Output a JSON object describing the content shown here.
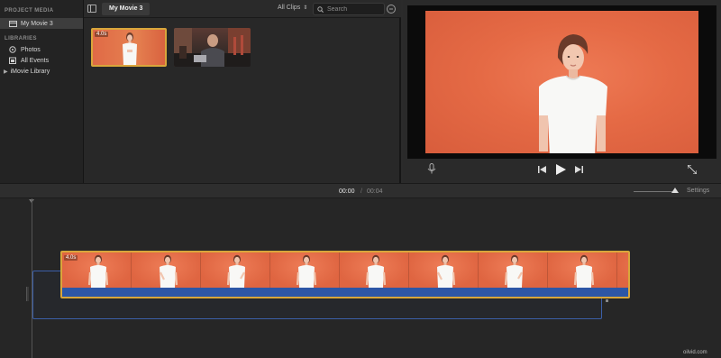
{
  "sidebar": {
    "project_media_header": "PROJECT MEDIA",
    "project_item": "My Movie 3",
    "libraries_header": "LIBRARIES",
    "library_items": [
      {
        "label": "Photos",
        "icon": "photos-icon"
      },
      {
        "label": "All Events",
        "icon": "calendar-icon"
      }
    ],
    "library_root": "iMovie Library"
  },
  "browser": {
    "tab_label": "My Movie 3",
    "clips_filter": "All Clips",
    "search_placeholder": "Search",
    "clips": [
      {
        "duration": "4.0s",
        "selected": true
      },
      {
        "duration": "",
        "selected": false
      }
    ]
  },
  "viewer": {
    "controls": [
      "microphone-icon",
      "skip-back-icon",
      "play-icon",
      "skip-forward-icon",
      "fullscreen-icon"
    ]
  },
  "timeline": {
    "current_time": "00:00",
    "separator": "/",
    "total_time": "00:04",
    "settings_label": "Settings",
    "clip_duration": "4.0s"
  },
  "watermark": "oilvid.com",
  "colors": {
    "selection": "#d9a63b",
    "audio": "#2d56a6",
    "video_bg": "#e56a45"
  }
}
